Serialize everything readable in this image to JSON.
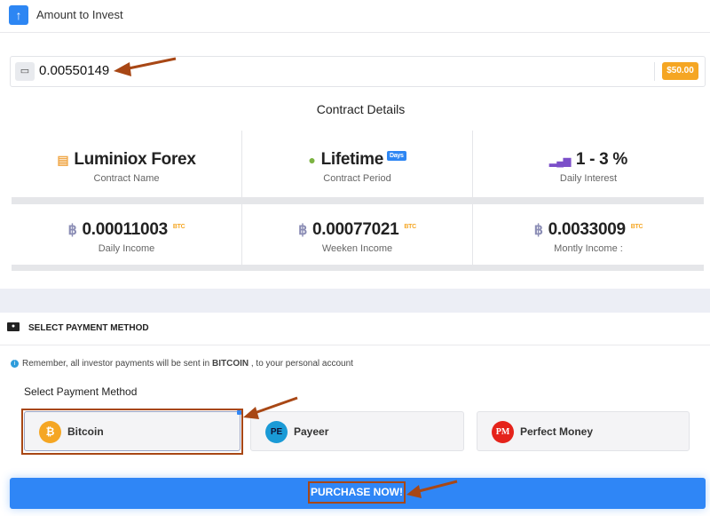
{
  "header": {
    "title": "Amount to Invest",
    "icon": "arrow-up-icon"
  },
  "amount": {
    "value": "0.00550149",
    "badge": "$50.00",
    "icon": "wallet-icon"
  },
  "contract": {
    "title": "Contract Details",
    "cells": [
      {
        "value": "Luminiox Forex",
        "label": "Contract Name",
        "icon": "document-icon"
      },
      {
        "value": "Lifetime",
        "badge": "Days",
        "label": "Contract Period",
        "icon": "clock-icon"
      },
      {
        "value": "1 - 3 %",
        "label": "Daily Interest",
        "icon": "signal-bars-icon"
      },
      {
        "value": "0.00011003",
        "unit": "BTC",
        "label": "Daily Income",
        "icon": "bitcoin-icon"
      },
      {
        "value": "0.00077021",
        "unit": "BTC",
        "label": "Weeken Income",
        "icon": "bitcoin-icon"
      },
      {
        "value": "0.0033009",
        "unit": "BTC",
        "label": "Montly Income :",
        "icon": "bitcoin-icon"
      }
    ]
  },
  "payment": {
    "header": "SELECT PAYMENT METHOD",
    "info_pre": "Remember, all investor payments will be sent in ",
    "info_bold": "BITCOIN",
    "info_post": " , to your personal account",
    "select_label": "Select Payment Method",
    "methods": [
      {
        "label": "Bitcoin",
        "logo": "₿",
        "selected": true
      },
      {
        "label": "Payeer",
        "logo": "PE"
      },
      {
        "label": "Perfect Money",
        "logo": "PM"
      }
    ],
    "purchase": "PURCHASE NOW!"
  },
  "colors": {
    "accent": "#2f86f6",
    "badge": "#f5a623",
    "annotation": "#a84715"
  }
}
